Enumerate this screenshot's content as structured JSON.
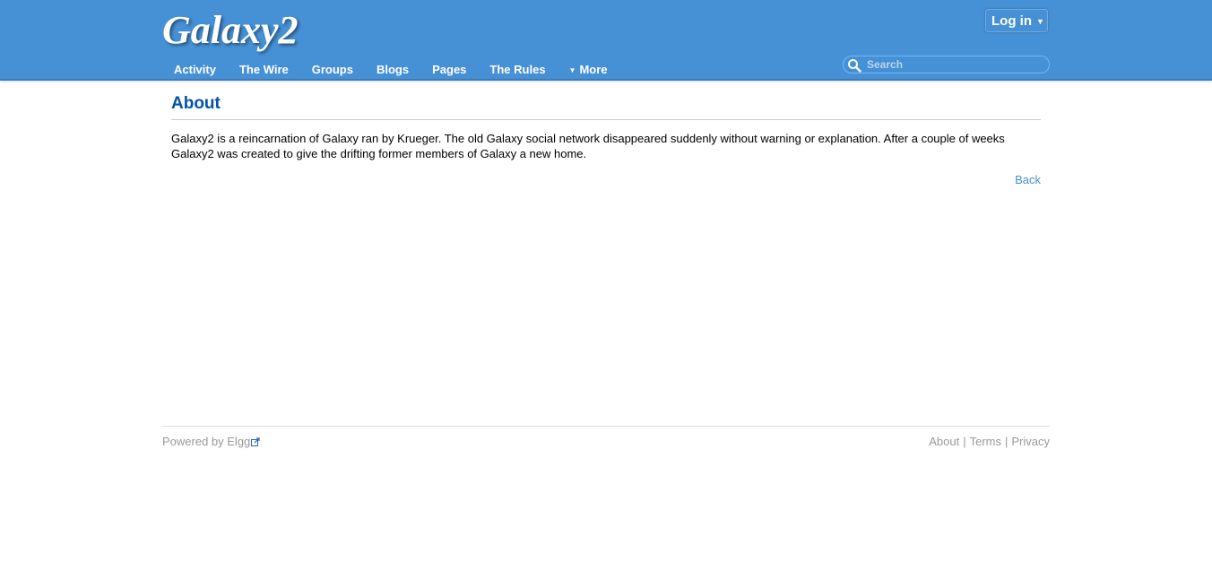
{
  "header": {
    "logo": "Galaxy2",
    "login_label": "Log in",
    "login_caret": "▼",
    "nav": {
      "activity": "Activity",
      "wire": "The Wire",
      "groups": "Groups",
      "blogs": "Blogs",
      "pages": "Pages",
      "rules": "The Rules",
      "more": "More",
      "more_caret": "▼"
    },
    "search": {
      "placeholder": "Search",
      "icon": "search-icon"
    }
  },
  "main": {
    "title": "About",
    "body": "Galaxy2 is a reincarnation of Galaxy ran by Krueger. The old Galaxy social network disappeared suddenly without warning or explanation. After a couple of weeks Galaxy2 was created to give the drifting former members of Galaxy a new home.",
    "back_label": "Back"
  },
  "footer": {
    "powered_prefix": "Powered by ",
    "powered_link": "Elgg",
    "links": {
      "about": "About",
      "terms": "Terms",
      "privacy": "Privacy"
    },
    "separator": "|"
  },
  "colors": {
    "header_bg": "#4690d6",
    "title": "#0054a7",
    "link": "#4690d6",
    "muted": "#999999"
  }
}
